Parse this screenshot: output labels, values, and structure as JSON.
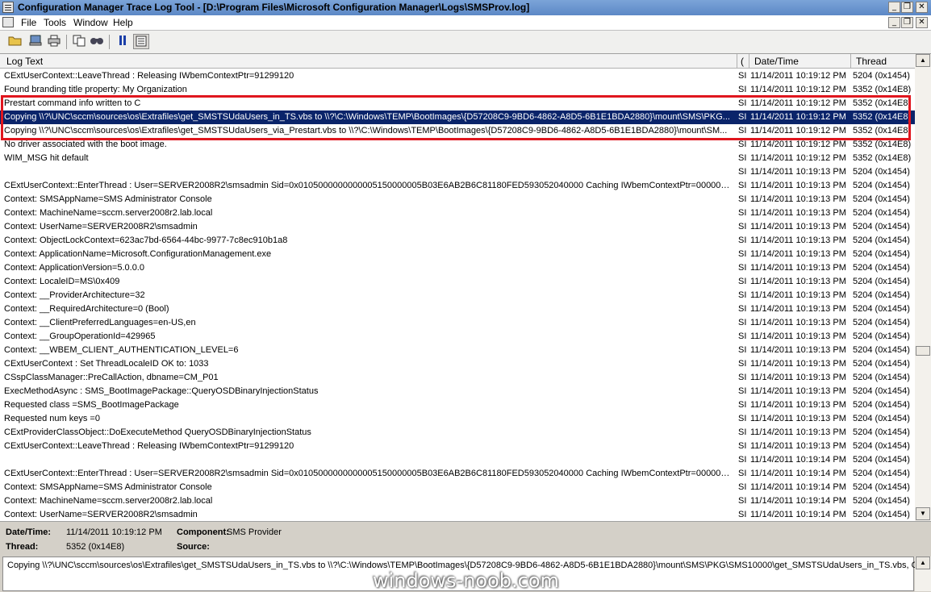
{
  "window": {
    "title": "Configuration Manager Trace Log Tool - [D:\\Program Files\\Microsoft Configuration Manager\\Logs\\SMSProv.log]",
    "controls": {
      "minimize": "_",
      "maximize": "❐",
      "close": "✕"
    },
    "mdi_controls": {
      "minimize": "_",
      "restore": "❐",
      "close": "✕"
    }
  },
  "menu": {
    "items": [
      {
        "label": "File"
      },
      {
        "label": "Tools"
      },
      {
        "label": "Window"
      },
      {
        "label": "Help"
      }
    ]
  },
  "toolbar": {
    "icons": [
      "open-folder-icon",
      "print-preview-icon",
      "print-icon",
      "copy-icon",
      "find-icon",
      "pause-icon",
      "highlight-icon"
    ]
  },
  "columns": {
    "text": "Log Text",
    "component": "(",
    "date": "Date/Time",
    "thread": "Thread"
  },
  "rows": [
    {
      "text": "CExtUserContext::LeaveThread : Releasing IWbemContextPtr=91299120",
      "comp": "SI",
      "date": "11/14/2011 10:19:12 PM",
      "thread": "5204 (0x1454)"
    },
    {
      "text": "Found branding title property: My Organization",
      "comp": "SI",
      "date": "11/14/2011 10:19:12 PM",
      "thread": "5352 (0x14E8)"
    },
    {
      "text": "Prestart command info written to C",
      "comp": "SI",
      "date": "11/14/2011 10:19:12 PM",
      "thread": "5352 (0x14E8)"
    },
    {
      "text": "Copying \\\\?\\UNC\\sccm\\sources\\os\\Extrafiles\\get_SMSTSUdaUsers_in_TS.vbs to \\\\?\\C:\\Windows\\TEMP\\BootImages\\{D57208C9-9BD6-4862-A8D5-6B1E1BDA2880}\\mount\\SMS\\PKG...",
      "comp": "SI",
      "date": "11/14/2011 10:19:12 PM",
      "thread": "5352 (0x14E8)",
      "selected": true
    },
    {
      "text": "Copying \\\\?\\UNC\\sccm\\sources\\os\\Extrafiles\\get_SMSTSUdaUsers_via_Prestart.vbs to \\\\?\\C:\\Windows\\TEMP\\BootImages\\{D57208C9-9BD6-4862-A8D5-6B1E1BDA2880}\\mount\\SM...",
      "comp": "SI",
      "date": "11/14/2011 10:19:12 PM",
      "thread": "5352 (0x14E8)"
    },
    {
      "text": "No driver associated with the boot image.",
      "comp": "SI",
      "date": "11/14/2011 10:19:12 PM",
      "thread": "5352 (0x14E8)"
    },
    {
      "text": "WIM_MSG hit default",
      "comp": "SI",
      "date": "11/14/2011 10:19:12 PM",
      "thread": "5352 (0x14E8)"
    },
    {
      "text": "",
      "comp": "SI",
      "date": "11/14/2011 10:19:13 PM",
      "thread": "5204 (0x1454)"
    },
    {
      "text": "CExtUserContext::EnterThread : User=SERVER2008R2\\smsadmin Sid=0x0105000000000005150000005B03E6AB2B6C81180FED593052040000 Caching IWbemContextPtr=00000000057...",
      "comp": "SI",
      "date": "11/14/2011 10:19:13 PM",
      "thread": "5204 (0x1454)"
    },
    {
      "text": "Context: SMSAppName=SMS Administrator Console",
      "comp": "SI",
      "date": "11/14/2011 10:19:13 PM",
      "thread": "5204 (0x1454)"
    },
    {
      "text": "Context: MachineName=sccm.server2008r2.lab.local",
      "comp": "SI",
      "date": "11/14/2011 10:19:13 PM",
      "thread": "5204 (0x1454)"
    },
    {
      "text": "Context: UserName=SERVER2008R2\\smsadmin",
      "comp": "SI",
      "date": "11/14/2011 10:19:13 PM",
      "thread": "5204 (0x1454)"
    },
    {
      "text": "Context: ObjectLockContext=623ac7bd-6564-44bc-9977-7c8ec910b1a8",
      "comp": "SI",
      "date": "11/14/2011 10:19:13 PM",
      "thread": "5204 (0x1454)"
    },
    {
      "text": "Context: ApplicationName=Microsoft.ConfigurationManagement.exe",
      "comp": "SI",
      "date": "11/14/2011 10:19:13 PM",
      "thread": "5204 (0x1454)"
    },
    {
      "text": "Context: ApplicationVersion=5.0.0.0",
      "comp": "SI",
      "date": "11/14/2011 10:19:13 PM",
      "thread": "5204 (0x1454)"
    },
    {
      "text": "Context: LocaleID=MS\\0x409",
      "comp": "SI",
      "date": "11/14/2011 10:19:13 PM",
      "thread": "5204 (0x1454)"
    },
    {
      "text": "Context: __ProviderArchitecture=32",
      "comp": "SI",
      "date": "11/14/2011 10:19:13 PM",
      "thread": "5204 (0x1454)"
    },
    {
      "text": "Context: __RequiredArchitecture=0 (Bool)",
      "comp": "SI",
      "date": "11/14/2011 10:19:13 PM",
      "thread": "5204 (0x1454)"
    },
    {
      "text": "Context: __ClientPreferredLanguages=en-US,en",
      "comp": "SI",
      "date": "11/14/2011 10:19:13 PM",
      "thread": "5204 (0x1454)"
    },
    {
      "text": "Context: __GroupOperationId=429965",
      "comp": "SI",
      "date": "11/14/2011 10:19:13 PM",
      "thread": "5204 (0x1454)"
    },
    {
      "text": "Context: __WBEM_CLIENT_AUTHENTICATION_LEVEL=6",
      "comp": "SI",
      "date": "11/14/2011 10:19:13 PM",
      "thread": "5204 (0x1454)"
    },
    {
      "text": "CExtUserContext : Set ThreadLocaleID OK to: 1033",
      "comp": "SI",
      "date": "11/14/2011 10:19:13 PM",
      "thread": "5204 (0x1454)"
    },
    {
      "text": "CSspClassManager::PreCallAction, dbname=CM_P01",
      "comp": "SI",
      "date": "11/14/2011 10:19:13 PM",
      "thread": "5204 (0x1454)"
    },
    {
      "text": "ExecMethodAsync : SMS_BootImagePackage::QueryOSDBinaryInjectionStatus",
      "comp": "SI",
      "date": "11/14/2011 10:19:13 PM",
      "thread": "5204 (0x1454)"
    },
    {
      "text": "Requested class =SMS_BootImagePackage",
      "comp": "SI",
      "date": "11/14/2011 10:19:13 PM",
      "thread": "5204 (0x1454)"
    },
    {
      "text": "Requested num keys =0",
      "comp": "SI",
      "date": "11/14/2011 10:19:13 PM",
      "thread": "5204 (0x1454)"
    },
    {
      "text": "CExtProviderClassObject::DoExecuteMethod QueryOSDBinaryInjectionStatus",
      "comp": "SI",
      "date": "11/14/2011 10:19:13 PM",
      "thread": "5204 (0x1454)"
    },
    {
      "text": "CExtUserContext::LeaveThread : Releasing IWbemContextPtr=91299120",
      "comp": "SI",
      "date": "11/14/2011 10:19:13 PM",
      "thread": "5204 (0x1454)"
    },
    {
      "text": "",
      "comp": "SI",
      "date": "11/14/2011 10:19:14 PM",
      "thread": "5204 (0x1454)"
    },
    {
      "text": "CExtUserContext::EnterThread : User=SERVER2008R2\\smsadmin Sid=0x0105000000000005150000005B03E6AB2B6C81180FED593052040000 Caching IWbemContextPtr=00000000057...",
      "comp": "SI",
      "date": "11/14/2011 10:19:14 PM",
      "thread": "5204 (0x1454)"
    },
    {
      "text": "Context: SMSAppName=SMS Administrator Console",
      "comp": "SI",
      "date": "11/14/2011 10:19:14 PM",
      "thread": "5204 (0x1454)"
    },
    {
      "text": "Context: MachineName=sccm.server2008r2.lab.local",
      "comp": "SI",
      "date": "11/14/2011 10:19:14 PM",
      "thread": "5204 (0x1454)"
    },
    {
      "text": "Context: UserName=SERVER2008R2\\smsadmin",
      "comp": "SI",
      "date": "11/14/2011 10:19:14 PM",
      "thread": "5204 (0x1454)"
    }
  ],
  "details": {
    "date_label": "Date/Time:",
    "date_value": "11/14/2011 10:19:12 PM",
    "component_label": "Component:",
    "component_value": "SMS Provider",
    "thread_label": "Thread:",
    "thread_value": "5352 (0x14E8)",
    "source_label": "Source:",
    "source_value": ""
  },
  "message": "Copying \\\\?\\UNC\\sccm\\sources\\os\\Extrafiles\\get_SMSTSUdaUsers_in_TS.vbs to \\\\?\\C:\\Windows\\TEMP\\BootImages\\{D57208C9-9BD6-4862-A8D5-6B1E1BDA2880}\\mount\\SMS\\PKG\\SMS10000\\get_SMSTSUdaUsers_in_TS.vbs, OK",
  "watermark": "windows-noob.com",
  "colors": {
    "selection": "#0a246a",
    "highlight_box": "#e0161e"
  }
}
